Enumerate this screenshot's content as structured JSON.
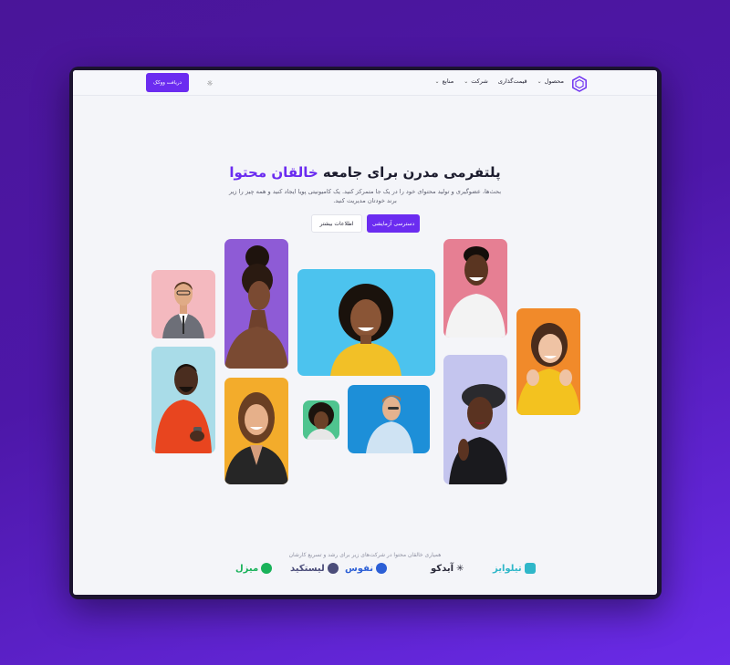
{
  "header": {
    "logo_icon": "hexagon-logo-icon",
    "menu": [
      {
        "label": "محصول",
        "has_dropdown": true
      },
      {
        "label": "قیمت‌گذاری",
        "has_dropdown": false
      },
      {
        "label": "شرکت",
        "has_dropdown": true
      },
      {
        "label": "منابع",
        "has_dropdown": true
      }
    ],
    "cta_label": "دریافت ووکک",
    "theme_icon": "sun-icon"
  },
  "hero": {
    "title_main": "پلتفرمی مدرن برای جامعه ",
    "title_accent": "خالقان محتوا",
    "subtitle": "بحث‌ها، عضوگیری و تولید محتوای خود را در یک جا متمرکز کنید. یک کامیونیتی پویا ایجاد کنید و همه چیز را زیر برند خودتان مدیریت کنید.",
    "primary_button": "دسترسی آزمایشی",
    "secondary_button": "اطلاعات بیشتر"
  },
  "partners": {
    "caption": "همیاری خالقان محتوا در شرکت‌های زیر برای رشد و تسریع کارشان",
    "logos": [
      {
        "name": "تیلوایز",
        "color": "#2fb7c9"
      },
      {
        "name": "آیدکو",
        "color": "#2a2a3a"
      },
      {
        "name": "نفوس",
        "color": "#2c5fd6"
      },
      {
        "name": "لیستکید",
        "color": "#4b4d7a"
      },
      {
        "name": "میزل",
        "color": "#19b25a"
      }
    ]
  },
  "colors": {
    "accent": "#6b2cf0",
    "background_gradient_start": "#4a1599",
    "background_gradient_end": "#6a2be8"
  }
}
